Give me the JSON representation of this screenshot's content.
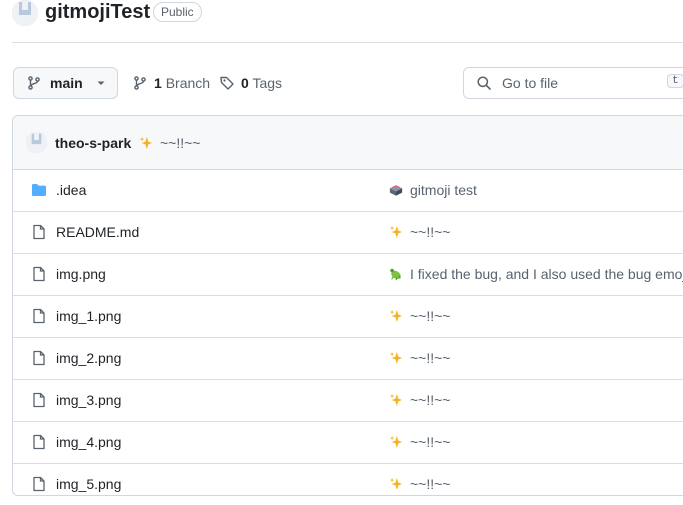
{
  "repo": {
    "name": "gitmojiTest",
    "visibility": "Public"
  },
  "toolbar": {
    "branch": "main",
    "branch_count": "1",
    "branch_word": "Branch",
    "tag_count": "0",
    "tag_word": "Tags",
    "search_placeholder": "Go to file",
    "search_shortcut": "t"
  },
  "latest_commit": {
    "author": "theo-s-park",
    "emoji": "sparkles",
    "message": "~~!!~~"
  },
  "files": [
    {
      "name": ".idea",
      "type": "folder",
      "commit_emoji": "card-file-box",
      "commit_message": "gitmoji test"
    },
    {
      "name": "README.md",
      "type": "file",
      "commit_emoji": "sparkles",
      "commit_message": "~~!!~~"
    },
    {
      "name": "img.png",
      "type": "file",
      "commit_emoji": "bug",
      "commit_message": "I fixed the bug, and I also used the bug emoji"
    },
    {
      "name": "img_1.png",
      "type": "file",
      "commit_emoji": "sparkles",
      "commit_message": "~~!!~~"
    },
    {
      "name": "img_2.png",
      "type": "file",
      "commit_emoji": "sparkles",
      "commit_message": "~~!!~~"
    },
    {
      "name": "img_3.png",
      "type": "file",
      "commit_emoji": "sparkles",
      "commit_message": "~~!!~~"
    },
    {
      "name": "img_4.png",
      "type": "file",
      "commit_emoji": "sparkles",
      "commit_message": "~~!!~~"
    },
    {
      "name": "img_5.png",
      "type": "file",
      "commit_emoji": "sparkles",
      "commit_message": "~~!!~~"
    }
  ],
  "colors": {
    "folder": "#54aeff",
    "border": "#d0d7de",
    "muted": "#59636e",
    "text": "#1f2328"
  }
}
